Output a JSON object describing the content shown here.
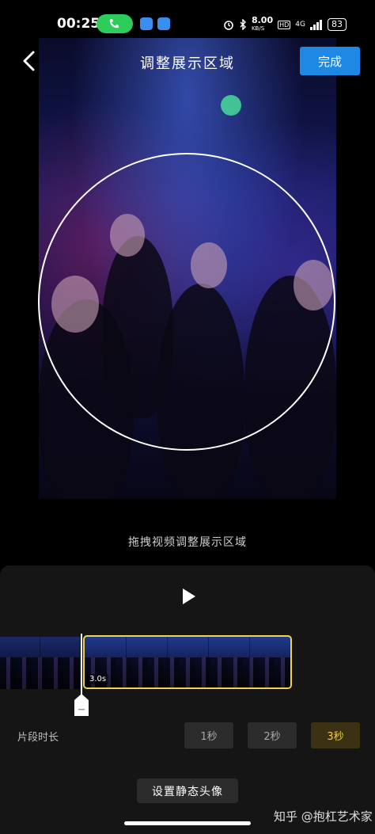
{
  "status_bar": {
    "time": "00:25",
    "net_speed_value": "8.00",
    "net_speed_unit": "KB/S",
    "hd": "HD",
    "network": "4G",
    "battery": "83"
  },
  "header": {
    "title": "调整展示区域",
    "done_label": "完成"
  },
  "hint": "拖拽视频调整展示区域",
  "timeline": {
    "duration_badge": "3.0s"
  },
  "segment": {
    "label": "片段时长",
    "options": [
      "1秒",
      "2秒",
      "3秒"
    ],
    "selected": "3秒"
  },
  "static_avatar_button": "设置静态头像",
  "watermark": "知乎 @抱杠艺术家",
  "colors": {
    "accent": "#1e88e5",
    "selection": "#f2d24a",
    "selected_text": "#f2c93a"
  }
}
